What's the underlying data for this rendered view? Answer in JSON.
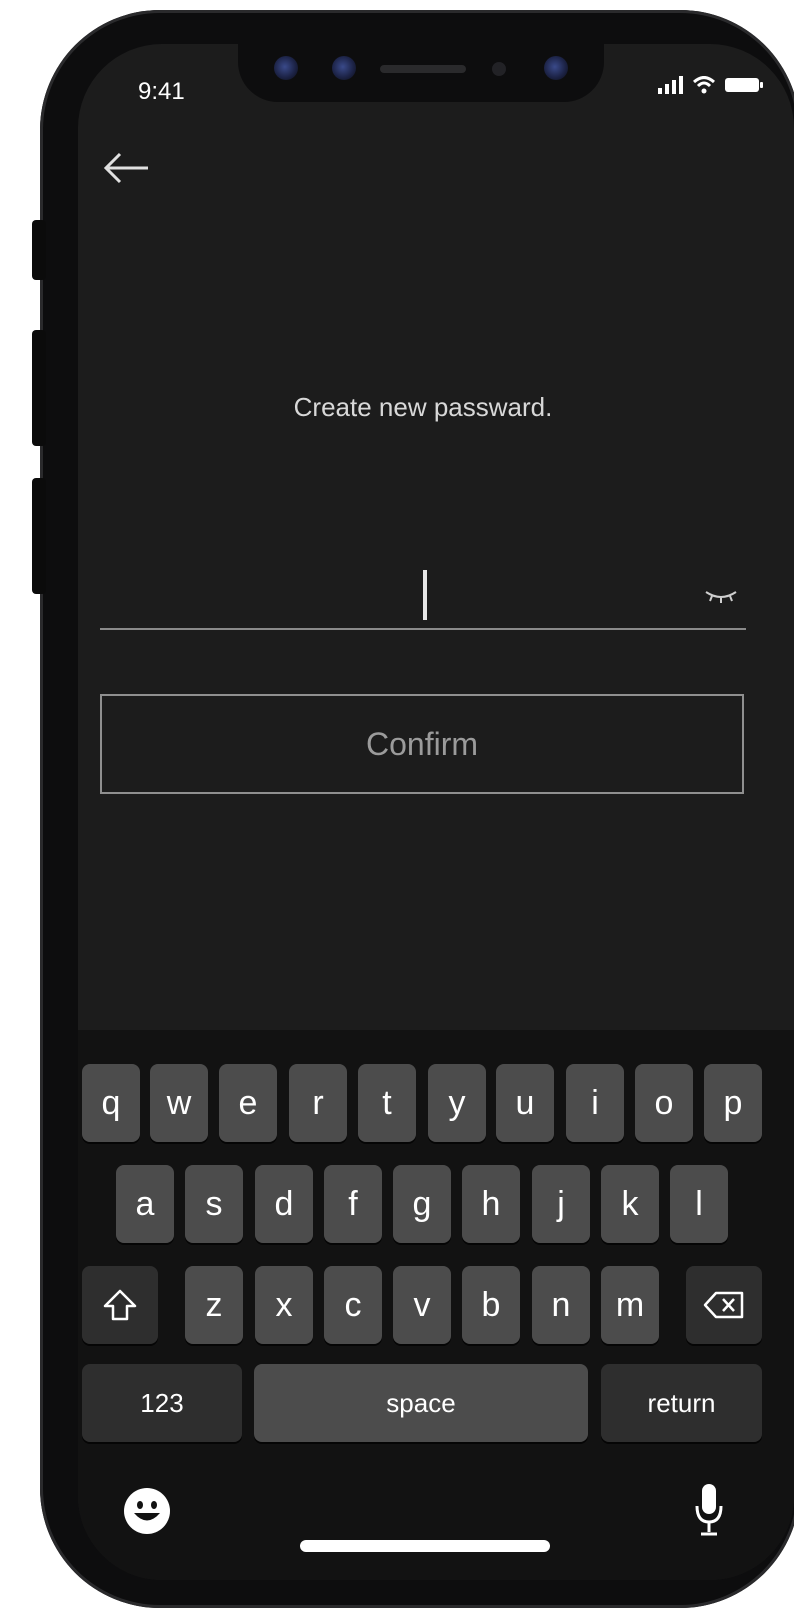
{
  "status_bar": {
    "time": "9:41"
  },
  "screen": {
    "headline": "Create new passward.",
    "password_field": {
      "value": ""
    },
    "confirm_button_label": "Confirm"
  },
  "keyboard": {
    "row1": [
      "q",
      "w",
      "e",
      "r",
      "t",
      "y",
      "u",
      "i",
      "o",
      "p"
    ],
    "row2": [
      "a",
      "s",
      "d",
      "f",
      "g",
      "h",
      "j",
      "k",
      "l"
    ],
    "row3": [
      "z",
      "x",
      "c",
      "v",
      "b",
      "n",
      "m"
    ],
    "numbers_label": "123",
    "space_label": "space",
    "return_label": "return",
    "shift_icon": "shift-icon",
    "delete_icon": "backspace-icon",
    "emoji_icon": "emoji-icon",
    "mic_icon": "microphone-icon"
  },
  "colors": {
    "screen_bg": "#1c1c1c",
    "keyboard_bg": "#121212",
    "key_bg": "#4c4c4c",
    "key_dark_bg": "#2e2e2e",
    "text": "#ffffff"
  }
}
